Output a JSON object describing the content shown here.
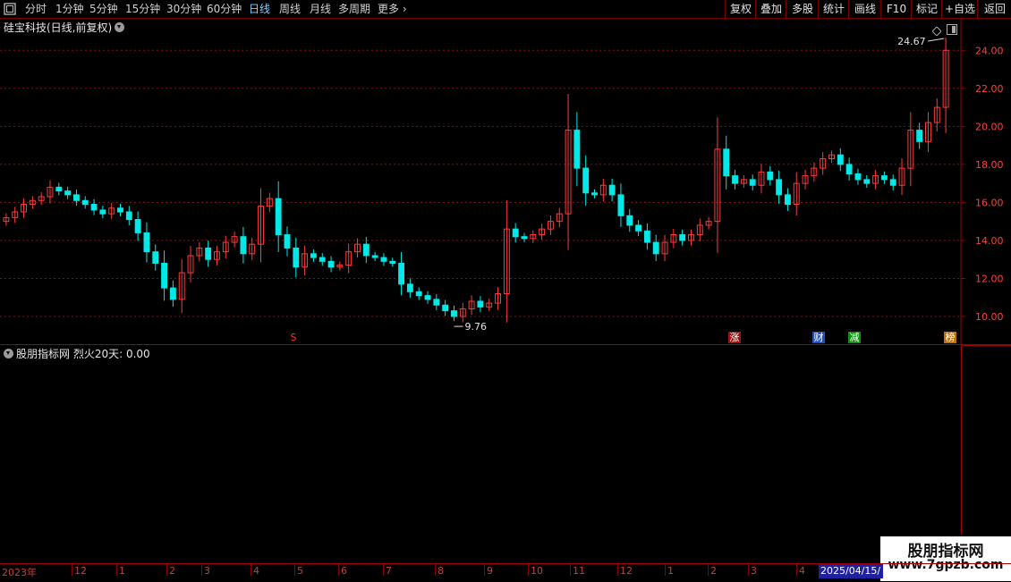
{
  "toolbar": {
    "periods": [
      "分时",
      "1分钟",
      "5分钟",
      "15分钟",
      "30分钟",
      "60分钟",
      "日线",
      "周线",
      "月线",
      "多周期",
      "更多"
    ],
    "active_period": "日线",
    "right_buttons": [
      "复权",
      "叠加",
      "多股",
      "统计",
      "画线",
      "F10",
      "+自选",
      "返回"
    ]
  },
  "stock": {
    "title": "硅宝科技(日线,前复权)",
    "max_label": "24.67",
    "min_label": "9.76"
  },
  "event_tags": [
    {
      "text": "S",
      "color": "#ff3030"
    },
    {
      "text": "涨",
      "color": "#ffffff",
      "bg": "#a01010"
    },
    {
      "text": "财",
      "color": "#ffffff",
      "bg": "#2050c0"
    },
    {
      "text": "减",
      "color": "#ffffff",
      "bg": "#109010"
    },
    {
      "text": "榜",
      "color": "#ffffff",
      "bg": "#c07010"
    }
  ],
  "indicator": {
    "title": "股朋指标网  烈火20天: 0.00"
  },
  "date_axis": {
    "labels": [
      "2023年",
      "12",
      "1",
      "2",
      "3",
      "4",
      "5",
      "6",
      "7",
      "8",
      "9",
      "10",
      "11",
      "12",
      "1",
      "2",
      "3",
      "4"
    ],
    "highlight": "2025/04/15/"
  },
  "watermark": {
    "line1": "股朋指标网",
    "line2": "www.7gpzb.com"
  },
  "colors": {
    "up": "#ff3a3a",
    "down": "#00e8e8",
    "grid": "#8a1010",
    "axis_text": "#ff4040"
  },
  "chart_data": {
    "type": "candlestick",
    "title": "硅宝科技(日线,前复权)",
    "ylim": [
      9.2,
      25.0
    ],
    "yticks": [
      10,
      12,
      14,
      16,
      18,
      20,
      22,
      24
    ],
    "ytick_labels": [
      "10.00",
      "12.00",
      "14.00",
      "16.00",
      "18.00",
      "20.00",
      "22.00",
      "24.00"
    ],
    "high": 24.67,
    "low": 9.76,
    "close_series": [
      15.2,
      15.5,
      15.9,
      16.1,
      16.3,
      16.8,
      16.6,
      16.4,
      16.1,
      15.9,
      15.6,
      15.4,
      15.7,
      15.5,
      15.1,
      14.4,
      13.4,
      12.8,
      11.5,
      10.9,
      12.3,
      13.2,
      13.6,
      13.0,
      13.4,
      13.9,
      14.2,
      13.3,
      13.8,
      15.8,
      16.2,
      14.3,
      13.6,
      12.6,
      13.3,
      13.1,
      12.9,
      12.6,
      12.7,
      13.4,
      13.8,
      13.2,
      13.1,
      12.9,
      12.8,
      11.7,
      11.3,
      11.1,
      10.9,
      10.6,
      10.3,
      10.0,
      10.4,
      10.8,
      10.5,
      10.7,
      11.2,
      14.6,
      14.2,
      14.1,
      14.3,
      14.6,
      15.0,
      15.4,
      19.8,
      17.8,
      16.5,
      16.4,
      16.9,
      16.4,
      15.3,
      14.8,
      14.5,
      13.9,
      13.3,
      13.9,
      14.3,
      14.0,
      14.3,
      14.8,
      15.0,
      18.8,
      17.4,
      17.0,
      17.2,
      16.9,
      17.6,
      17.2,
      16.4,
      15.9,
      17.0,
      17.4,
      17.8,
      18.3,
      18.5,
      18.0,
      17.5,
      17.2,
      17.0,
      17.4,
      17.2,
      16.9,
      17.8,
      19.8,
      19.2,
      20.2,
      21.0,
      24.0
    ]
  }
}
